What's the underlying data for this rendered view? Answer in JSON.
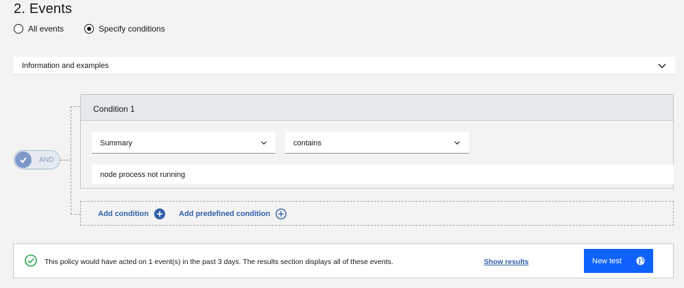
{
  "section": {
    "title": "2. Events"
  },
  "radios": [
    {
      "label": "All events",
      "checked": false
    },
    {
      "label": "Specify conditions",
      "checked": true
    }
  ],
  "accordion": {
    "label": "Information and examples",
    "icon": "chevron-down-icon"
  },
  "logic_toggle": {
    "label": "AND",
    "enabled": true
  },
  "condition": {
    "title": "Condition 1",
    "field": {
      "value": "Summary"
    },
    "operator": {
      "value": "contains"
    },
    "value": "node process not running"
  },
  "actions": {
    "add_condition": "Add condition",
    "add_predefined": "Add predefined condition"
  },
  "test": {
    "message": "This policy would have acted on 1 event(s) in the past 3 days. The results section displays all of these events.",
    "show_results": "Show results",
    "new_test": "New test"
  },
  "colors": {
    "primary_button": "#0f62fe",
    "link": "#2f5fa8",
    "success": "#24a148",
    "toggle_knob": "#7d98c8"
  }
}
